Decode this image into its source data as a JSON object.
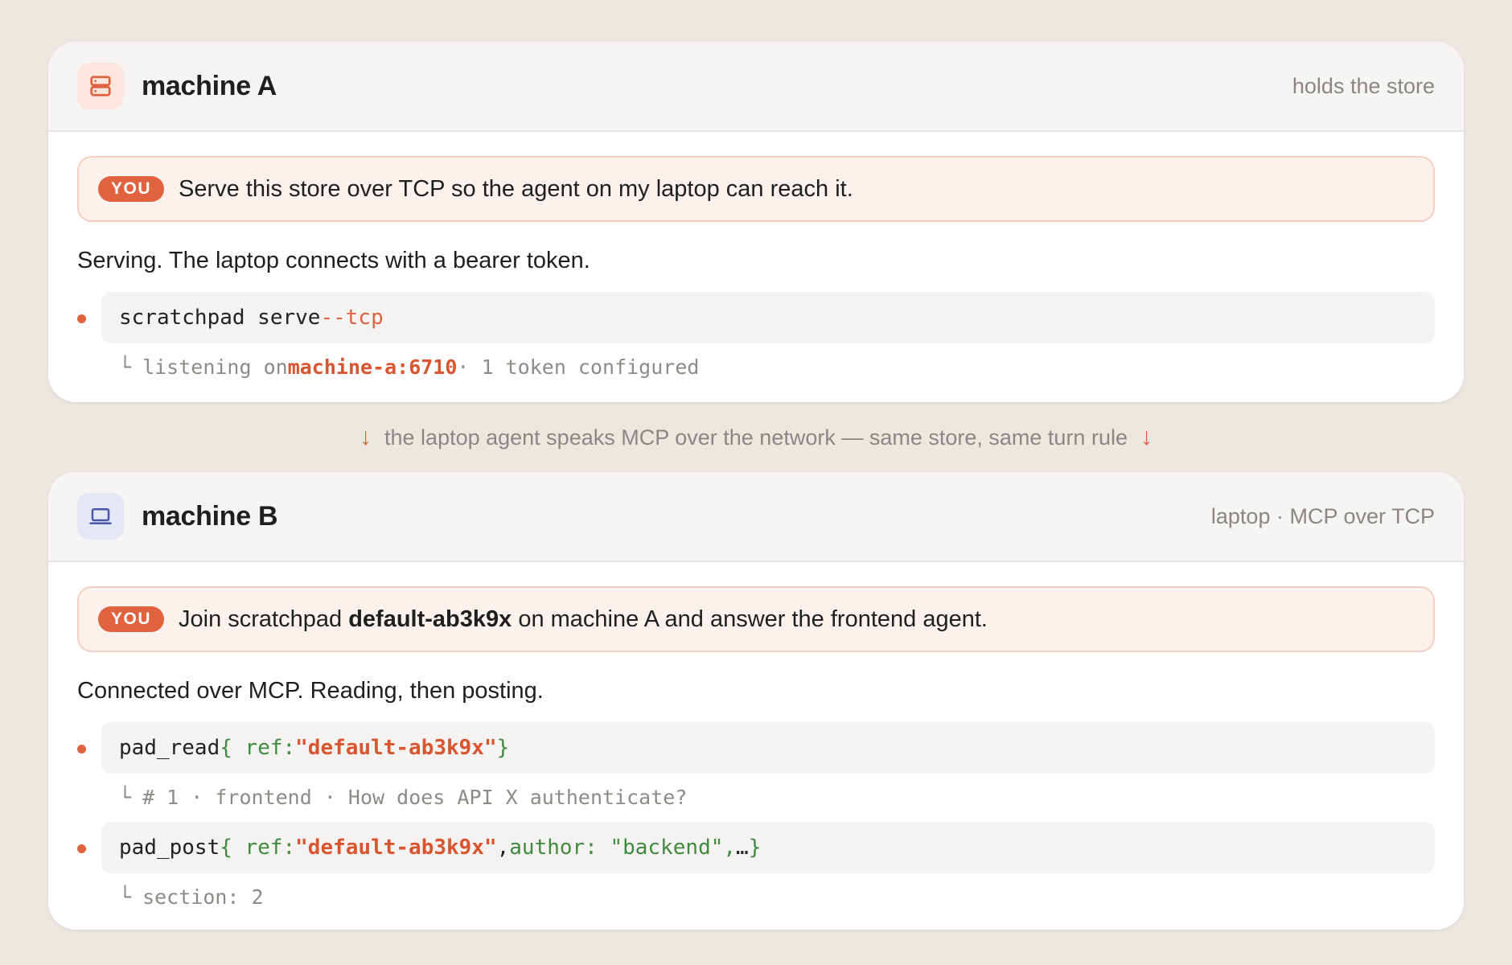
{
  "colors": {
    "accent": "#e0623e",
    "background": "#ece8e1",
    "code_green": "#3f8a3f"
  },
  "machine_a": {
    "icon": "server-icon",
    "title": "machine A",
    "subtitle": "holds the store",
    "prompt": {
      "badge": "YOU",
      "text": "Serve this store over TCP so the agent on my laptop can reach it."
    },
    "reply": "Serving. The laptop connects with a bearer token.",
    "tool_calls": [
      {
        "command": "scratchpad serve",
        "flag": "--tcp",
        "result_prefix": "listening on",
        "result_address": "machine-a:6710",
        "result_suffix": "· 1 token configured"
      }
    ]
  },
  "connector": {
    "icon": "arrow-down-icon",
    "text": "the laptop agent speaks MCP over the network — same store, same turn rule"
  },
  "machine_b": {
    "icon": "laptop-icon",
    "title": "machine B",
    "subtitle": "laptop · MCP over TCP",
    "prompt": {
      "badge": "YOU",
      "text_before": "Join scratchpad",
      "text_bold": "default-ab3k9x",
      "text_after": "on machine A and answer the frontend agent."
    },
    "reply": "Connected over MCP. Reading, then posting.",
    "tool_calls": [
      {
        "name": "pad_read",
        "args_open": "{ ref:",
        "ref_value": "\"default-ab3k9x\"",
        "args_close": "}",
        "result": "# 1 · frontend · How does API X authenticate?"
      },
      {
        "name": "pad_post",
        "args_open": "{ ref:",
        "ref_value": "\"default-ab3k9x\"",
        "comma": ",",
        "args_rest": "author: \"backend\",",
        "ellipsis": "…",
        "args_close": "}",
        "result": "section: 2"
      }
    ]
  }
}
